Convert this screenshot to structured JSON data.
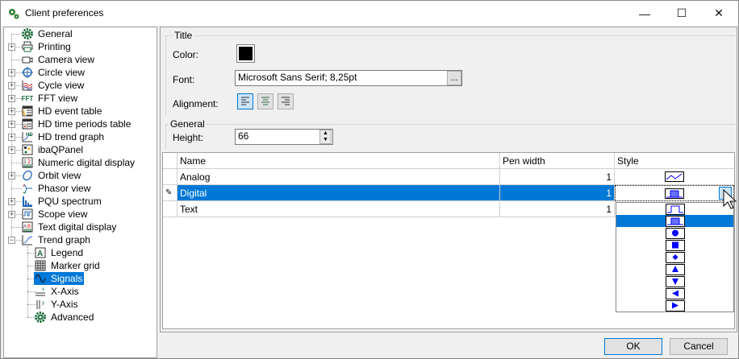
{
  "window": {
    "title": "Client preferences",
    "minimize": "—",
    "maximize": "☐",
    "close": "✕"
  },
  "tree": {
    "items": [
      {
        "label": "General",
        "icon": "gear-icon",
        "expandable": false
      },
      {
        "label": "Printing",
        "icon": "printer-icon",
        "expandable": true
      },
      {
        "label": "Camera view",
        "icon": "camera-icon",
        "expandable": false
      },
      {
        "label": "Circle view",
        "icon": "circle-view-icon",
        "expandable": true
      },
      {
        "label": "Cycle view",
        "icon": "cycle-view-icon",
        "expandable": true
      },
      {
        "label": "FFT view",
        "icon": "fft-icon",
        "expandable": true
      },
      {
        "label": "HD event table",
        "icon": "hd-event-table-icon",
        "expandable": true
      },
      {
        "label": "HD time periods table",
        "icon": "hd-time-periods-icon",
        "expandable": true
      },
      {
        "label": "HD trend graph",
        "icon": "hd-trend-graph-icon",
        "expandable": true
      },
      {
        "label": "ibaQPanel",
        "icon": "qpanel-icon",
        "expandable": true
      },
      {
        "label": "Numeric digital display",
        "icon": "numeric-display-icon",
        "expandable": false
      },
      {
        "label": "Orbit view",
        "icon": "orbit-icon",
        "expandable": true
      },
      {
        "label": "Phasor view",
        "icon": "phasor-icon",
        "expandable": false
      },
      {
        "label": "PQU spectrum",
        "icon": "spectrum-icon",
        "expandable": true
      },
      {
        "label": "Scope view",
        "icon": "scope-icon",
        "expandable": true
      },
      {
        "label": "Text digital display",
        "icon": "text-display-icon",
        "expandable": false
      },
      {
        "label": "Trend graph",
        "icon": "trend-graph-icon",
        "expandable": true,
        "expanded": true
      }
    ],
    "children": [
      {
        "label": "Legend",
        "icon": "legend-icon"
      },
      {
        "label": "Marker grid",
        "icon": "grid-icon"
      },
      {
        "label": "Signals",
        "icon": "sine-wave-icon",
        "selected": true
      },
      {
        "label": "X-Axis",
        "icon": "x-axis-icon"
      },
      {
        "label": "Y-Axis",
        "icon": "y-axis-icon"
      },
      {
        "label": "Advanced",
        "icon": "gear-icon"
      }
    ]
  },
  "title_group": {
    "label": "Title",
    "color_label": "Color:",
    "color_value": "#000000",
    "font_label": "Font:",
    "font_value": "Microsoft Sans Serif; 8,25pt",
    "font_button": "...",
    "alignment_label": "Alignment:",
    "alignment_selected": "left"
  },
  "general_group": {
    "label": "General",
    "height_label": "Height:",
    "height_value": "66"
  },
  "grid": {
    "columns": [
      "Name",
      "Pen width",
      "Style"
    ],
    "rows": [
      {
        "name": "Analog",
        "pen_width": "1",
        "style": "line"
      },
      {
        "name": "Digital",
        "pen_width": "1",
        "style": "filled-step",
        "selected": true
      },
      {
        "name": "Text",
        "pen_width": "1",
        "style": ""
      }
    ],
    "style_options": [
      "step",
      "filled-step",
      "circle",
      "square",
      "diamond",
      "triangle-up",
      "triangle-down",
      "triangle-left",
      "triangle-right"
    ],
    "style_selected": "filled-step"
  },
  "buttons": {
    "ok": "OK",
    "cancel": "Cancel"
  },
  "colors": {
    "accent": "#0078d7",
    "marker": "#0000ff"
  }
}
